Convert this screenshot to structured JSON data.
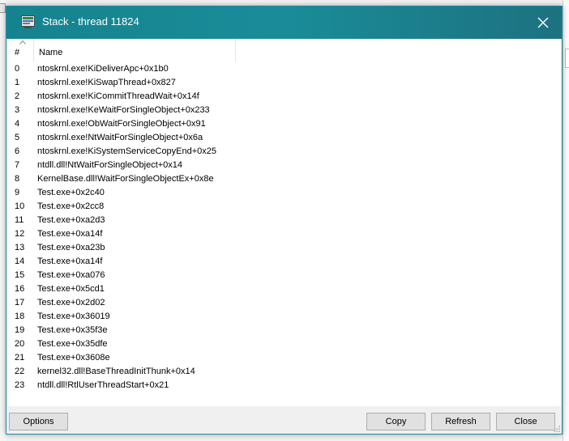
{
  "window": {
    "title": "Stack - thread 11824",
    "icon": "stack-window-icon",
    "close_icon": "close-icon"
  },
  "columns": {
    "hash": "#",
    "name": "Name"
  },
  "frames": [
    {
      "index": "0",
      "name": "ntoskrnl.exe!KiDeliverApc+0x1b0"
    },
    {
      "index": "1",
      "name": "ntoskrnl.exe!KiSwapThread+0x827"
    },
    {
      "index": "2",
      "name": "ntoskrnl.exe!KiCommitThreadWait+0x14f"
    },
    {
      "index": "3",
      "name": "ntoskrnl.exe!KeWaitForSingleObject+0x233"
    },
    {
      "index": "4",
      "name": "ntoskrnl.exe!ObWaitForSingleObject+0x91"
    },
    {
      "index": "5",
      "name": "ntoskrnl.exe!NtWaitForSingleObject+0x6a"
    },
    {
      "index": "6",
      "name": "ntoskrnl.exe!KiSystemServiceCopyEnd+0x25"
    },
    {
      "index": "7",
      "name": "ntdll.dll!NtWaitForSingleObject+0x14"
    },
    {
      "index": "8",
      "name": "KernelBase.dll!WaitForSingleObjectEx+0x8e"
    },
    {
      "index": "9",
      "name": "Test.exe+0x2c40"
    },
    {
      "index": "10",
      "name": "Test.exe+0x2cc8"
    },
    {
      "index": "11",
      "name": "Test.exe+0xa2d3"
    },
    {
      "index": "12",
      "name": "Test.exe+0xa14f"
    },
    {
      "index": "13",
      "name": "Test.exe+0xa23b"
    },
    {
      "index": "14",
      "name": "Test.exe+0xa14f"
    },
    {
      "index": "15",
      "name": "Test.exe+0xa076"
    },
    {
      "index": "16",
      "name": "Test.exe+0x5cd1"
    },
    {
      "index": "17",
      "name": "Test.exe+0x2d02"
    },
    {
      "index": "18",
      "name": "Test.exe+0x36019"
    },
    {
      "index": "19",
      "name": "Test.exe+0x35f3e"
    },
    {
      "index": "20",
      "name": "Test.exe+0x35dfe"
    },
    {
      "index": "21",
      "name": "Test.exe+0x3608e"
    },
    {
      "index": "22",
      "name": "kernel32.dll!BaseThreadInitThunk+0x14"
    },
    {
      "index": "23",
      "name": "ntdll.dll!RtlUserThreadStart+0x21"
    }
  ],
  "buttons": {
    "options": "Options",
    "copy": "Copy",
    "refresh": "Refresh",
    "close": "Close"
  },
  "colors": {
    "titlebar": "#1a8c99",
    "list_background": "#ffffff",
    "dialog_background": "#f0f0f0"
  }
}
